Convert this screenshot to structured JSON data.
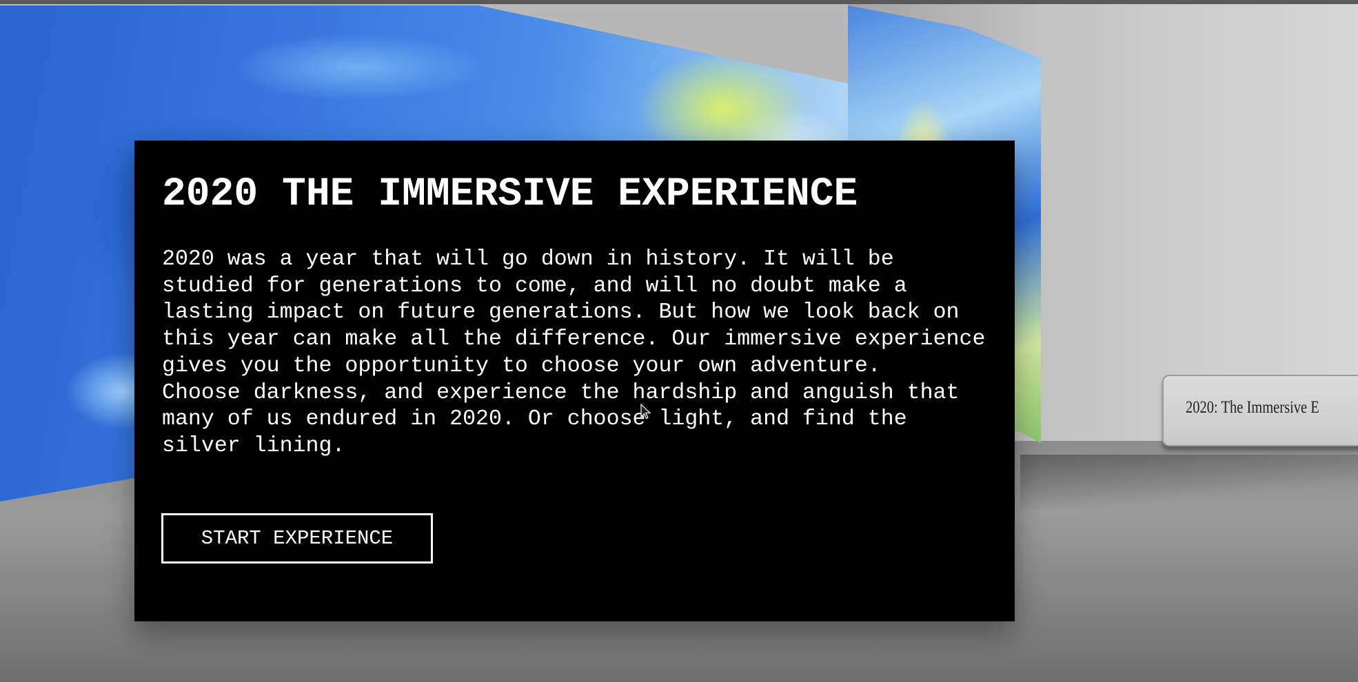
{
  "modal": {
    "title": "2020 THE IMMERSIVE EXPERIENCE",
    "paragraph_1": "2020 was a year that will go down in history. It will be studied for generations to come, and will no doubt make a lasting impact on future generations. But how we look back on this year can make all the difference. Our immersive experience gives you the opportunity to choose your own adventure.",
    "paragraph_2": "Choose darkness, and experience the hardship and anguish that many of us endured in 2020. Or choose light, and find the silver lining.",
    "start_button_label": "START EXPERIENCE"
  },
  "scene": {
    "plaque_label": "2020: The Immersive E"
  },
  "colors": {
    "modal_background": "#000000",
    "modal_text": "#ffffff",
    "button_border": "#ffffff"
  },
  "icons": {
    "cursor": "mouse-pointer-icon"
  }
}
